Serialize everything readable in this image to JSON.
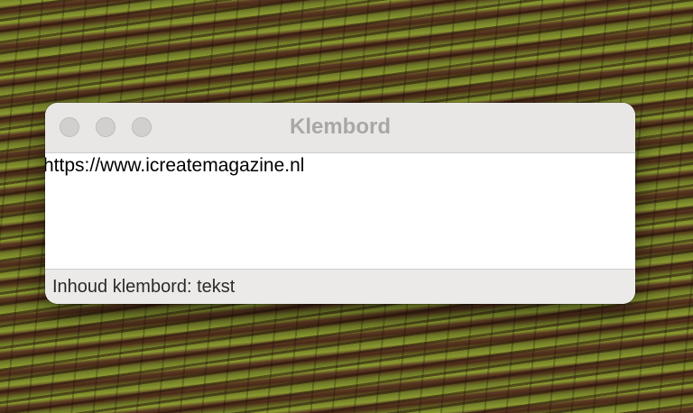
{
  "window": {
    "title": "Klembord",
    "controls": {
      "close": {
        "icon": "close-button-icon"
      },
      "minimize": {
        "icon": "minimize-button-icon"
      },
      "zoom": {
        "icon": "zoom-button-icon"
      }
    }
  },
  "clipboard": {
    "content": "https://www.icreatemagazine.nl"
  },
  "status": {
    "text": "Inhoud klembord: tekst"
  },
  "colors": {
    "titlebar": "#e9e7e6",
    "title_text": "#a9a7a6",
    "inactive_traffic_light": "#d2d0cf",
    "statusbar": "#eceae9"
  }
}
